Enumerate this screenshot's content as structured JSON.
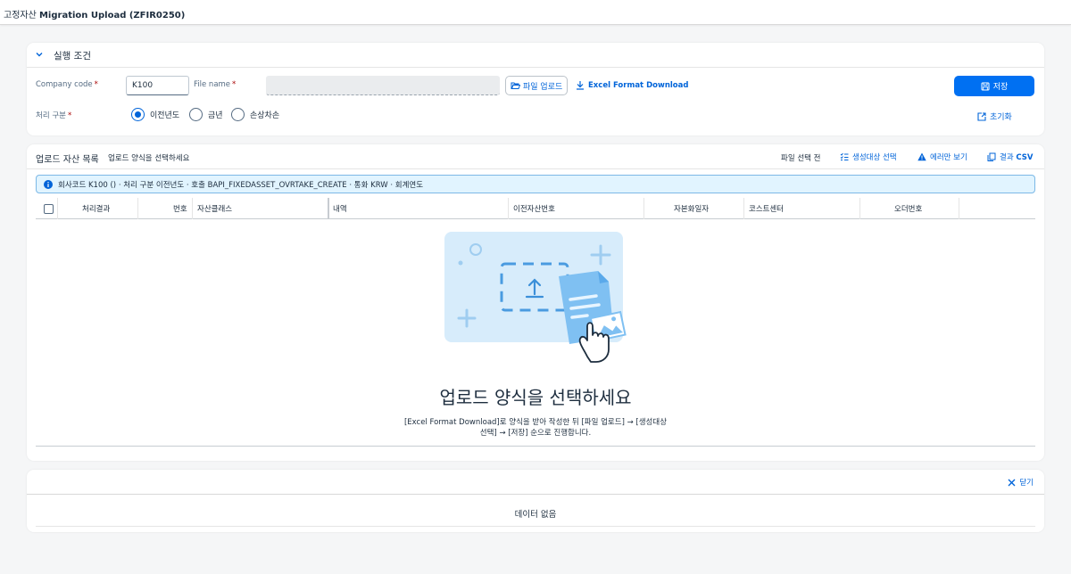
{
  "shell": {
    "title_prefix": "고정자산 ",
    "title_main": "Migration Upload (ZFIR0250)"
  },
  "filter": {
    "title": "실행 조건",
    "company_code_label": "Company code",
    "company_code_value": "K100",
    "file_name_label": "File name",
    "upload_button": "파일 업로드",
    "excel_download": "Excel Format Download",
    "save_button": "저장",
    "process_type_label": "처리 구분",
    "options": [
      "이전년도",
      "금년",
      "손상차손"
    ],
    "reset_button": "초기화"
  },
  "assets": {
    "title": "업로드 자산 목록",
    "subtitle": "업로드 양식을 선택하세요",
    "status": "파일 선택 전",
    "tool_select": "생성대상 선택",
    "tool_errors": "에러만 보기",
    "tool_csv_prefix": "결과 ",
    "tool_csv_bold": "CSV",
    "info": "회사코드 K100 () · 처리 구분 이전년도 · 호출 BAPI_FIXEDASSET_OVRTAKE_CREATE · 통화 KRW · 회계연도",
    "columns": [
      "처리결과",
      "번호",
      "자산클래스",
      "내역",
      "이전자산번호",
      "자본화일자",
      "코스트센터",
      "오더번호"
    ],
    "empty_title": "업로드 양식을 선택하세요",
    "empty_desc": "[Excel Format Download]로 양식을 받아 작성한 뒤 [파일 업로드] → [생성대상 선택] → [저장] 순으로 진행합니다."
  },
  "detail": {
    "close_label": "닫기",
    "no_data": "데이터 없음"
  },
  "colors": {
    "accent": "#0064d9",
    "primary": "#0070f2",
    "required": "#aa0808",
    "info_bg": "#e1f4ff"
  }
}
